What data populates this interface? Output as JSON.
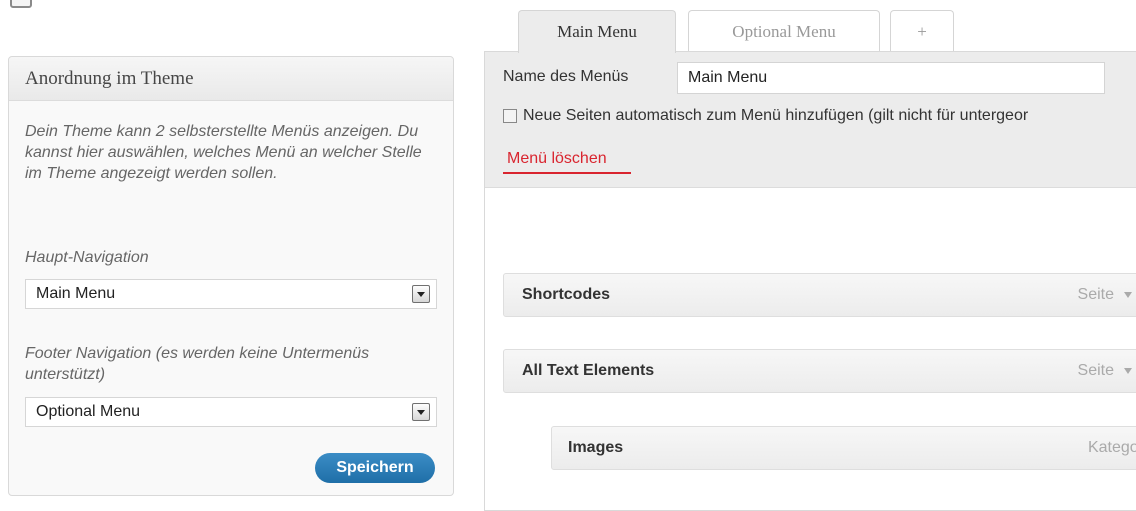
{
  "left": {
    "title": "Anordnung im Theme",
    "description": "Dein Theme kann 2 selbsterstellte Menüs anzeigen. Du kannst hier auswählen, welches Menü an welcher Stelle im Theme angezeigt werden sollen.",
    "main_nav_label": "Haupt-Navigation",
    "main_nav_value": "Main Menu",
    "footer_nav_label": "Footer Navigation (es werden keine Untermenüs unterstützt)",
    "footer_nav_value": "Optional Menu",
    "save_label": "Speichern"
  },
  "tabs": [
    {
      "label": "Main Menu",
      "active": true
    },
    {
      "label": "Optional Menu",
      "active": false
    },
    {
      "label": "+",
      "active": false
    }
  ],
  "editor": {
    "name_label": "Name des Menüs",
    "name_value": "Main Menu",
    "auto_add_label": "Neue Seiten automatisch zum Menü hinzufügen (gilt nicht für untergeor",
    "delete_label": "Menü löschen"
  },
  "menu_items": [
    {
      "title": "Shortcodes",
      "type": "Seite"
    },
    {
      "title": "All Text Elements",
      "type": "Seite"
    },
    {
      "title": "Images",
      "type": "Kategor"
    }
  ],
  "colors": {
    "delete_link": "#d9252f",
    "save_button": "#2a7ab6"
  }
}
